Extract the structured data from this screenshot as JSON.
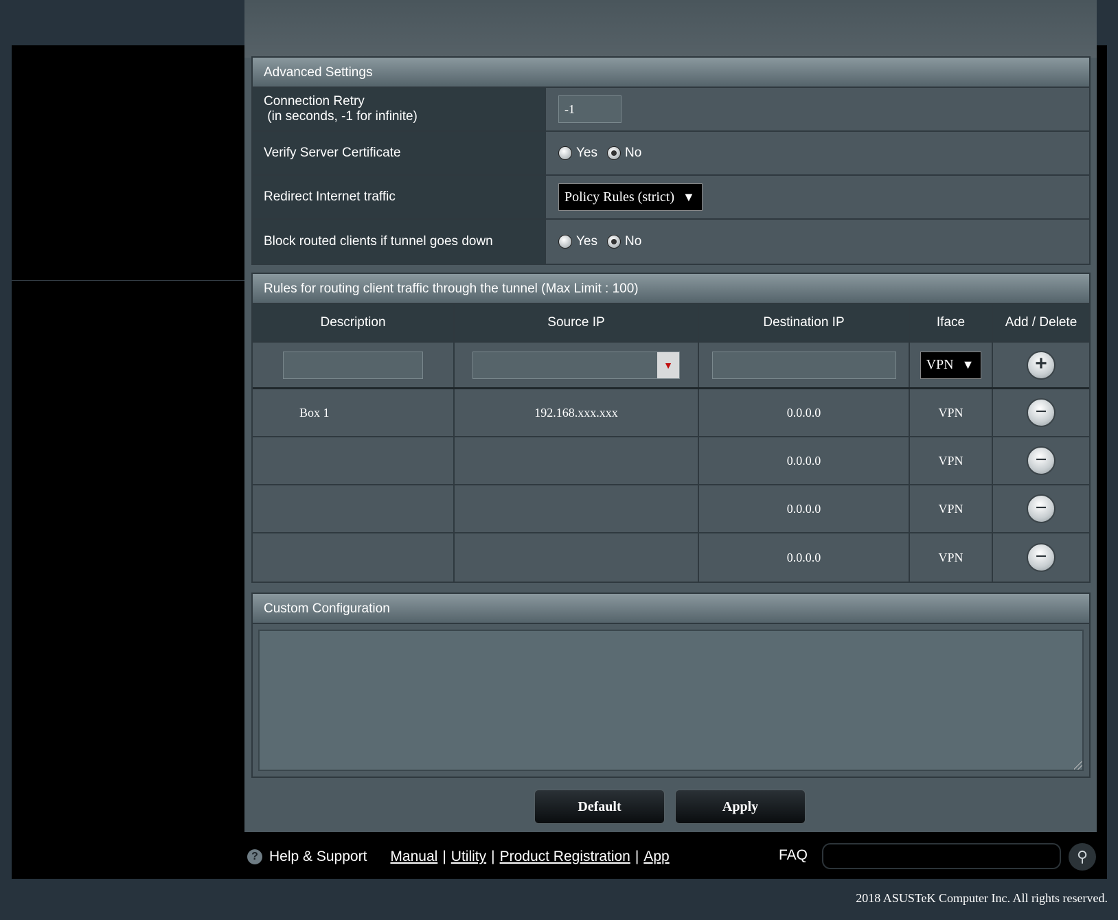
{
  "advanced": {
    "title": "Advanced Settings",
    "retry_label": "Connection Retry",
    "retry_sub": " (in seconds, -1 for infinite)",
    "retry_value": "-1",
    "verify_label": "Verify Server Certificate",
    "verify_yes": "Yes",
    "verify_no": "No",
    "verify_selected": "No",
    "redirect_label": "Redirect Internet traffic",
    "redirect_value": "Policy Rules (strict)",
    "block_label": "Block routed clients if tunnel goes down",
    "block_yes": "Yes",
    "block_no": "No",
    "block_selected": "No"
  },
  "rules": {
    "title": "Rules for routing client traffic through the tunnel (Max Limit : 100)",
    "columns": [
      "Description",
      "Source IP",
      "Destination IP",
      "Iface",
      "Add / Delete"
    ],
    "new_iface": "VPN",
    "rows": [
      {
        "description": "Box 1",
        "source": "192.168.xxx.xxx",
        "dest": "0.0.0.0",
        "iface": "VPN"
      },
      {
        "description": "",
        "source": "",
        "dest": "0.0.0.0",
        "iface": "VPN"
      },
      {
        "description": "",
        "source": "",
        "dest": "0.0.0.0",
        "iface": "VPN"
      },
      {
        "description": "",
        "source": "",
        "dest": "0.0.0.0",
        "iface": "VPN"
      }
    ]
  },
  "custom": {
    "title": "Custom Configuration",
    "value": ""
  },
  "buttons": {
    "default": "Default",
    "apply": "Apply"
  },
  "footer": {
    "help": "Help & Support",
    "manual": "Manual",
    "utility": "Utility",
    "registration": "Product Registration",
    "app": "App",
    "faq": "FAQ",
    "copyright": "2018 ASUSTeK Computer Inc. All rights reserved."
  },
  "icons": {
    "help": "help-icon",
    "add": "plus-circle-icon",
    "delete": "minus-circle-icon",
    "search": "search-icon"
  }
}
